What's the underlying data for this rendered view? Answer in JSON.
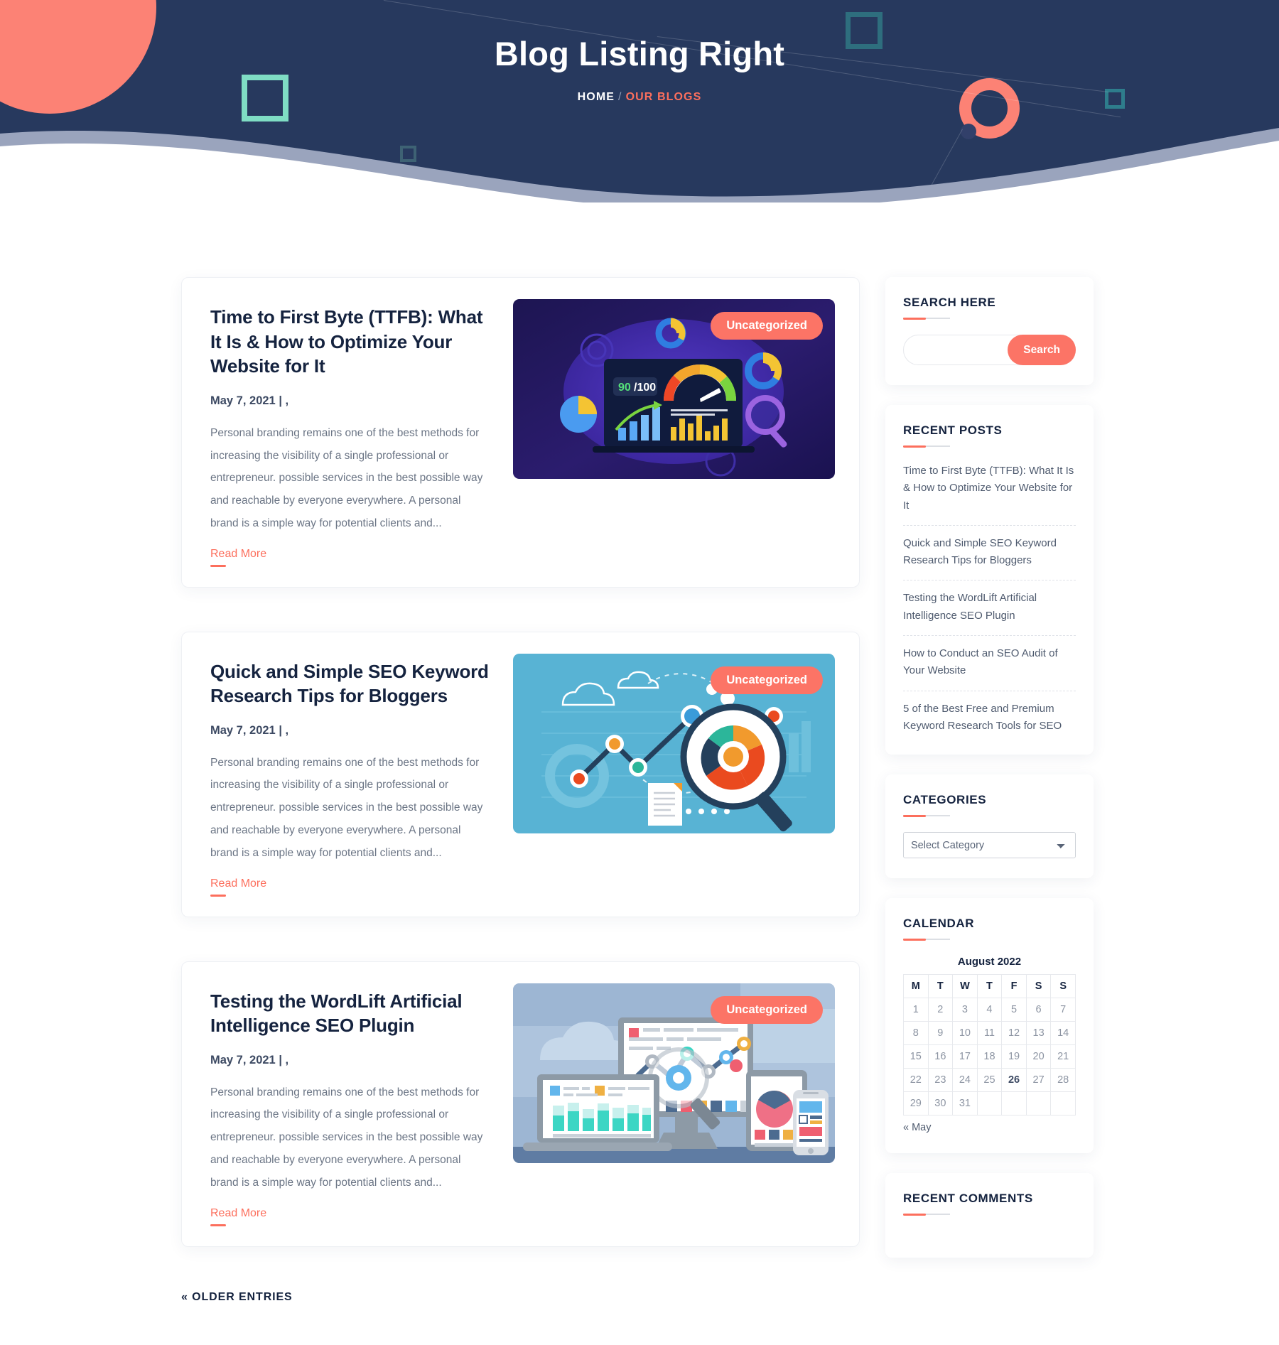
{
  "hero": {
    "title": "Blog Listing Right",
    "breadcrumb": {
      "home": "HOME",
      "separator": "/",
      "current": "OUR BLOGS"
    }
  },
  "theme": {
    "accent": "#fc6f5d",
    "badge": "#fc7466",
    "hero_bg": "#27395e",
    "heading": "#15233f",
    "body_text": "#6b7585",
    "wave_light": "#9aa4bd"
  },
  "posts": [
    {
      "title": "Time to First Byte (TTFB): What It Is & How to Optimize Your Website for It",
      "date": "May 7, 2021 | ,",
      "excerpt": "Personal branding remains one of the best methods for increasing the visibility of a single professional or entrepreneur. possible services in the best possible way and reachable by everyone everywhere. A personal brand is a simple way for potential clients and...",
      "read_more": "Read More",
      "category_badge": "Uncategorized",
      "image_name": "ttfb-speed-dashboard-illustration"
    },
    {
      "title": "Quick and Simple SEO Keyword Research Tips for Bloggers",
      "date": "May 7, 2021 | ,",
      "excerpt": "Personal branding remains one of the best methods for increasing the visibility of a single professional or entrepreneur. possible services in the best possible way and reachable by everyone everywhere. A personal brand is a simple way for potential clients and...",
      "read_more": "Read More",
      "category_badge": "Uncategorized",
      "image_name": "seo-keyword-analytics-illustration"
    },
    {
      "title": "Testing the WordLift Artificial Intelligence SEO Plugin",
      "date": "May 7, 2021 | ,",
      "excerpt": "Personal branding remains one of the best methods for increasing the visibility of a single professional or entrepreneur. possible services in the best possible way and reachable by everyone everywhere. A personal brand is a simple way for potential clients and...",
      "read_more": "Read More",
      "category_badge": "Uncategorized",
      "image_name": "multi-device-analytics-illustration"
    }
  ],
  "pagination": {
    "older_entries": "« OLDER ENTRIES"
  },
  "sidebar": {
    "search": {
      "title": "SEARCH HERE",
      "value": "",
      "placeholder": "",
      "button_label": "Search"
    },
    "recent_posts": {
      "title": "RECENT POSTS",
      "items": [
        "Time to First Byte (TTFB): What It Is & How to Optimize Your Website for It",
        "Quick and Simple SEO Keyword Research Tips for Bloggers",
        "Testing the WordLift Artificial Intelligence SEO Plugin",
        "How to Conduct an SEO Audit of Your Website",
        "5 of the Best Free and Premium Keyword Research Tools for SEO"
      ]
    },
    "categories": {
      "title": "CATEGORIES",
      "selected": "Select Category",
      "options": [
        "Select Category"
      ]
    },
    "calendar": {
      "title": "CALENDAR",
      "caption": "August 2022",
      "day_headers": [
        "M",
        "T",
        "W",
        "T",
        "F",
        "S",
        "S"
      ],
      "weeks": [
        [
          "1",
          "2",
          "3",
          "4",
          "5",
          "6",
          "7"
        ],
        [
          "8",
          "9",
          "10",
          "11",
          "12",
          "13",
          "14"
        ],
        [
          "15",
          "16",
          "17",
          "18",
          "19",
          "20",
          "21"
        ],
        [
          "22",
          "23",
          "24",
          "25",
          "26",
          "27",
          "28"
        ],
        [
          "29",
          "30",
          "31",
          "",
          "",
          "",
          ""
        ]
      ],
      "today": "26",
      "prev_link": "« May"
    },
    "recent_comments": {
      "title": "RECENT COMMENTS",
      "items": []
    }
  }
}
